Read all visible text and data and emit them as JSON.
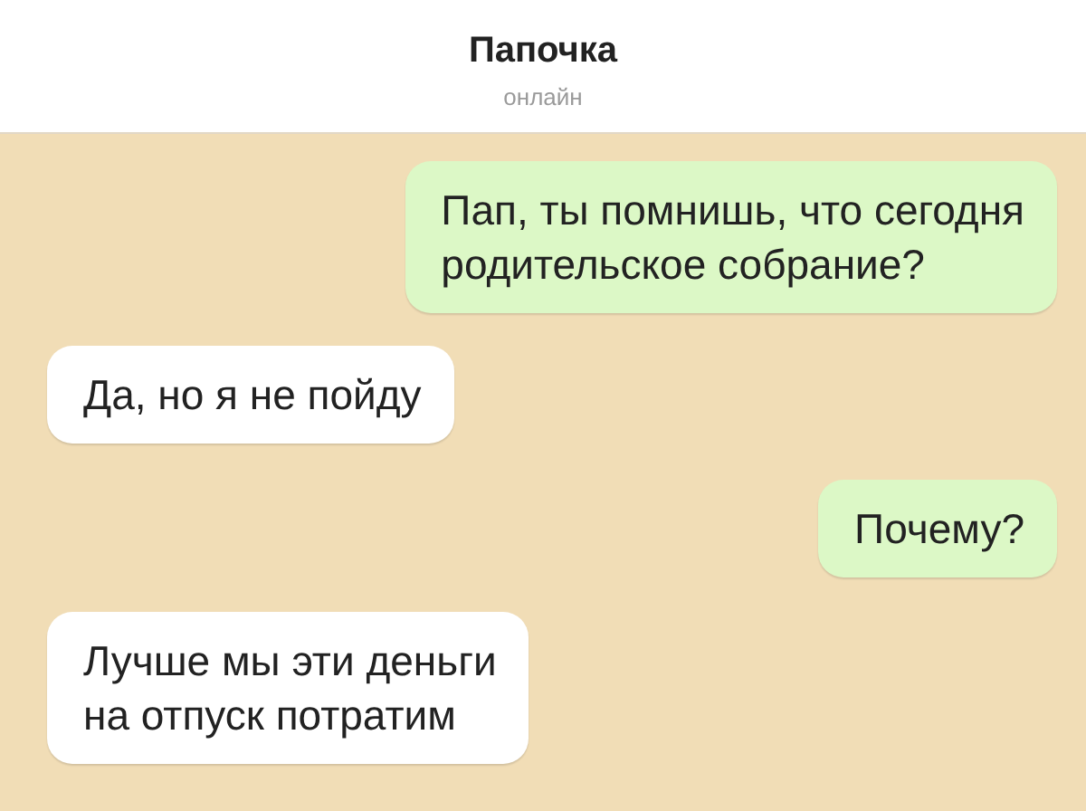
{
  "header": {
    "title": "Папочка",
    "status": "онлайн"
  },
  "messages": [
    {
      "kind": "outgoing",
      "lines": [
        "Пап, ты помнишь, что сегодня",
        "родительское собрание?"
      ]
    },
    {
      "kind": "incoming",
      "lines": [
        "Да, но я не пойду"
      ]
    },
    {
      "kind": "outgoing",
      "lines": [
        "Почему?"
      ]
    },
    {
      "kind": "incoming",
      "lines": [
        "Лучше мы эти деньги",
        "на отпуск потратим"
      ]
    }
  ]
}
